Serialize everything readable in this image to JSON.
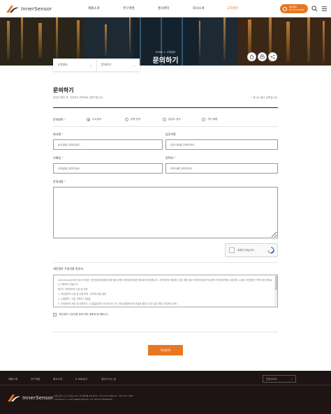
{
  "header": {
    "brand": "InnerSensor",
    "nav": [
      "제품소개",
      "연구개발",
      "홍보센터",
      "회사소개",
      "고객센터"
    ],
    "active_nav": "고객센터",
    "contact_line1": "문의전화",
    "contact_line2": "054-270-0066"
  },
  "hero": {
    "breadcrumb": "HOME  >  고객센터",
    "title": "문의하기"
  },
  "subnav": [
    "고객센터",
    "문의하기"
  ],
  "form": {
    "title": "문의하기",
    "description": "담당자 확인 후, 작성하신 연락처로 답변드립니다.",
    "required_note": "* 표시는 필수 입력입니다.",
    "category_label": "문의항목",
    "categories": [
      "수소센서",
      "압력 센서",
      "온습도 센서",
      "기타 제품"
    ],
    "selected_category": "수소센서",
    "company_label": "회사명",
    "company_placeholder": "회사명을 입력하세요.",
    "manager_label": "담당자명",
    "manager_placeholder": "담당자명을 입력하세요.",
    "email_label": "이메일",
    "email_placeholder": "이메일을 입력하세요.",
    "phone_label": "연락처",
    "phone_placeholder": "연락처를 입력하세요.",
    "content_label": "문의내용",
    "captcha_label": "로봇이 아닙니다.",
    "privacy_title": "개인정보 수집이용 동의서",
    "privacy_text": [
      "InnerSensor(이하 '회사'라 함)는 개인정보보호법에 따른 정보주체의 개인정보보호를 중요하게 생각합니다. 개인정보를 제공하는 경우 해당 정보 처리에 필요한 최소한의 개인정보만을 수집하며, 수집된 개인정보는 목적 외의 용도로는 이용되지 않습니다.",
      "제1조. 개인정보의 수집 및 이용",
      "1. 개인정보의 수집 및 이용 목적 : 문의에 대한 응대",
      "2. 수집항목 : 기업, 연락처, 이메일",
      "3. 개인정보의 보유 및 이용기간 : 수집일로부터 3년 후 파기 (단, 관계 법령에 따라 보존할 필요가 있는 경우 해당 기간까지 보관)"
    ],
    "agree_label": "개인정보 수집이용 동의서에 내용에 동의합니다.",
    "submit_label": "작성완료"
  },
  "footer": {
    "links": [
      "제품소개",
      "연구개발",
      "회사소개",
      "E-브로슈어",
      "찾아오시는 길"
    ],
    "family_site": "관련사이트",
    "brand": "InnerSensor",
    "address": "경북 포항시 남구 지곡로 394, 제 2벤처동 301호    Tel : 054-270-0066    Fax : 054-223-7999",
    "copyright": "COPYRIGHT © 2024 INNER-SENSOR. ALL RIGHTS RESERVED."
  },
  "colors": {
    "accent": "#e87722",
    "footer_bg": "#1e1414"
  },
  "icons": [
    "search-icon",
    "menu-icon",
    "home-icon",
    "print-icon",
    "share-icon",
    "phone-icon"
  ]
}
